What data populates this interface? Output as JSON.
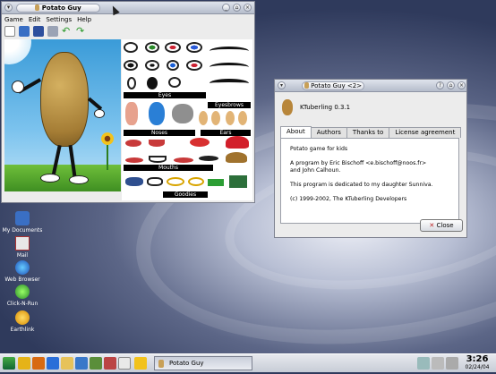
{
  "potato_window": {
    "title": "Potato Guy",
    "menu": [
      "Game",
      "Edit",
      "Settings",
      "Help"
    ],
    "toolbar_icons": [
      "new-icon",
      "open-icon",
      "save-icon",
      "print-icon",
      "undo-icon",
      "redo-icon"
    ],
    "categories": {
      "eyes": "Eyes",
      "eyebrows": "Eyesbrows",
      "noses": "Noses",
      "ears": "Ears",
      "mouths": "Mouths",
      "goodies": "Goodies"
    }
  },
  "about_dialog": {
    "title": "Potato Guy <2>",
    "app_name": "KTuberling 0.3.1",
    "tabs": [
      "About",
      "Authors",
      "Thanks to",
      "License agreement"
    ],
    "description": "Potato game for kids",
    "author_line1": "A program by Eric Bischoff <e.bischoff@noos.fr>",
    "author_line2": "and John Calhoun.",
    "dedication": "This program is dedicated to my daughter Sunniva.",
    "copyright": "(c) 1999-2002, The KTuberling Developers",
    "close_label": "Close"
  },
  "desktop_icons": [
    {
      "label": "My Documents",
      "icon": "documents-icon"
    },
    {
      "label": "Mail",
      "icon": "mail-icon"
    },
    {
      "label": "Web Browser",
      "icon": "web-browser-icon"
    },
    {
      "label": "Click-N-Run",
      "icon": "click-n-run-icon"
    },
    {
      "label": "Earthlink",
      "icon": "earthlink-icon"
    }
  ],
  "taskbar": {
    "task_label": "Potato Guy",
    "time": "3:26",
    "date": "02/24/04"
  }
}
